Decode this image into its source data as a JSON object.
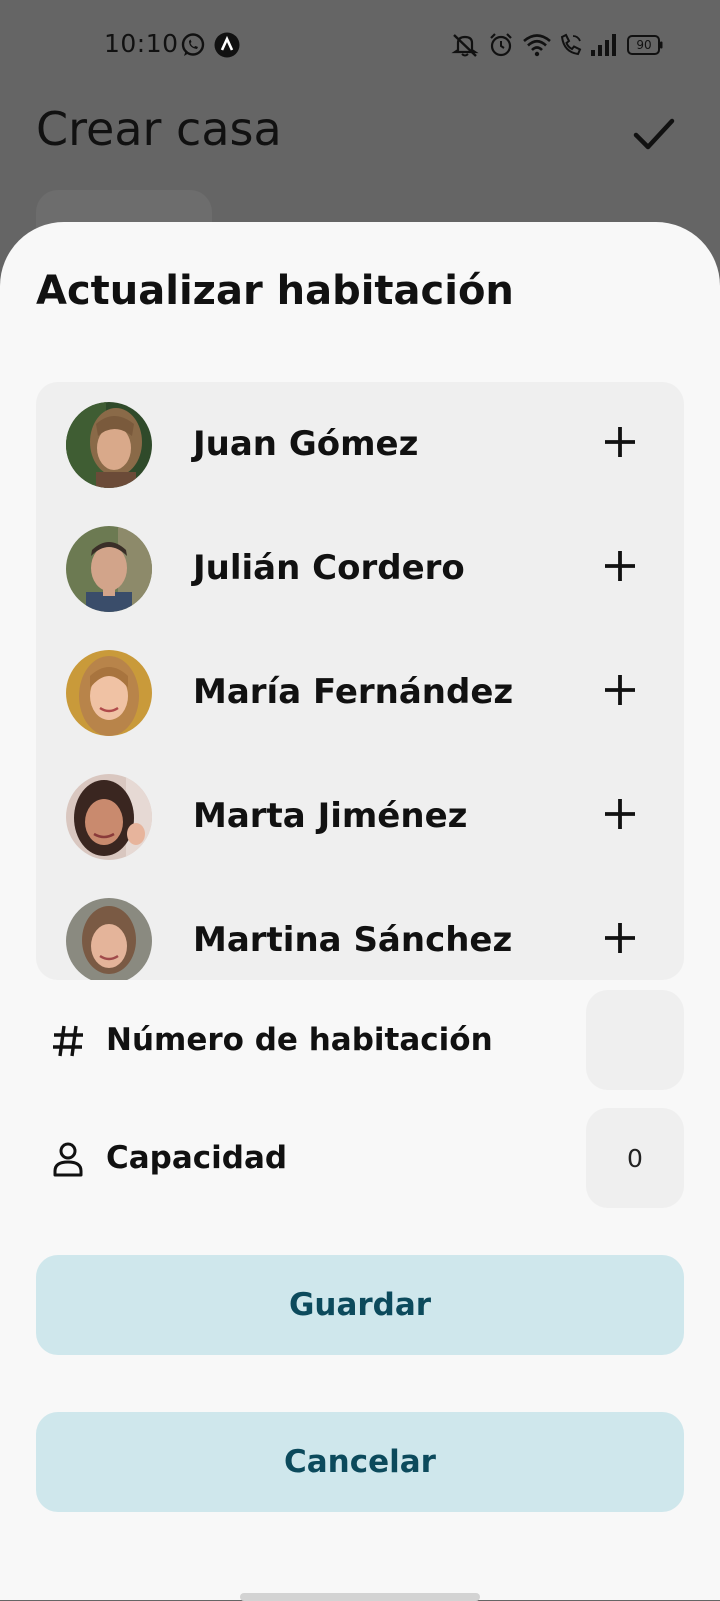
{
  "status_bar": {
    "time": "10:10",
    "battery": "90",
    "icons": [
      "whatsapp-icon",
      "app-a-icon",
      "mute-icon",
      "alarm-icon",
      "wifi-icon",
      "wifi-call-icon",
      "signal-icon",
      "battery-icon"
    ]
  },
  "background_page": {
    "title": "Crear casa",
    "confirm_icon": "check-icon"
  },
  "sheet": {
    "title": "Actualizar habitación",
    "people": [
      {
        "name": "Juan Gómez",
        "action_icon": "plus-icon"
      },
      {
        "name": "Julián Cordero",
        "action_icon": "plus-icon"
      },
      {
        "name": "María Fernández",
        "action_icon": "plus-icon"
      },
      {
        "name": "Marta Jiménez",
        "action_icon": "plus-icon"
      },
      {
        "name": "Martina Sánchez",
        "action_icon": "plus-icon"
      }
    ],
    "fields": {
      "room_number": {
        "label": "Número de habitación",
        "value": "",
        "icon": "hash-icon"
      },
      "capacity": {
        "label": "Capacidad",
        "value": "0",
        "icon": "person-icon"
      }
    },
    "save_label": "Guardar",
    "cancel_label": "Cancelar"
  },
  "colors": {
    "scrim": "#656565",
    "sheet_bg": "#f8f8f8",
    "list_bg": "#efefef",
    "button_bg": "#cfe7ec",
    "button_text": "#0c4a5c"
  }
}
